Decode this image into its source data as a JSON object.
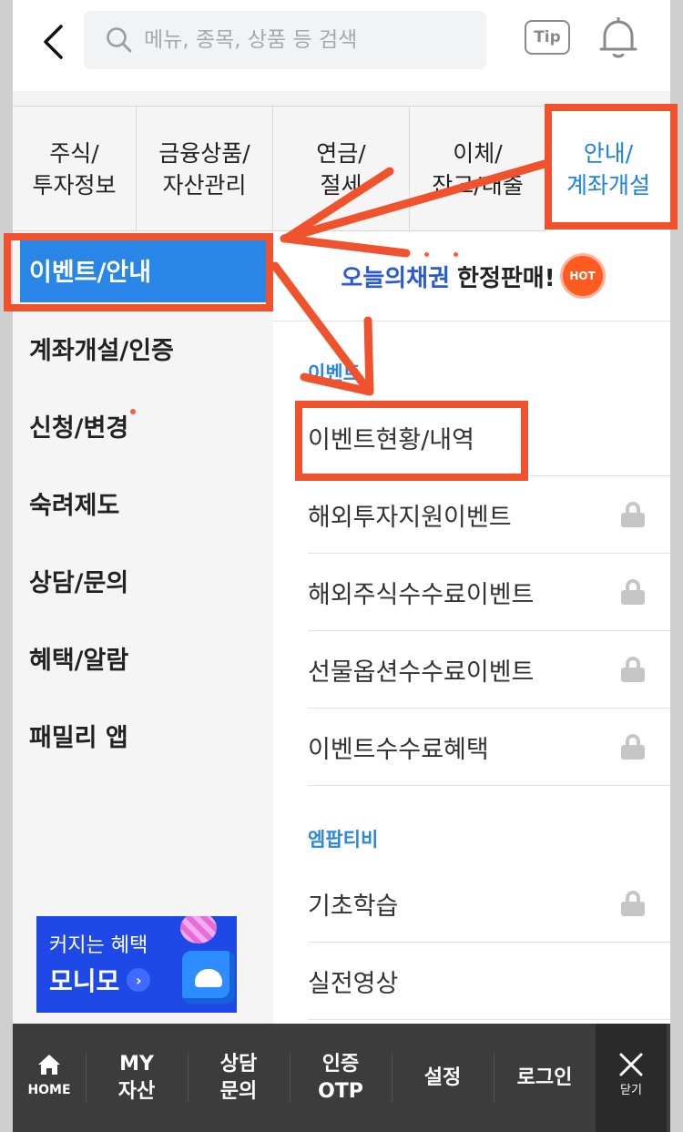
{
  "header": {
    "search_placeholder": "메뉴, 종목, 상품 등 검색",
    "tip_label": "Tip"
  },
  "tabs": [
    {
      "line1": "주식/",
      "line2": "투자정보"
    },
    {
      "line1": "금융상품/",
      "line2": "자산관리"
    },
    {
      "line1": "연금/",
      "line2": "절세"
    },
    {
      "line1": "이체/",
      "line2": "잔고/대출"
    },
    {
      "line1": "안내/",
      "line2": "계좌개설"
    }
  ],
  "sidebar": {
    "items": [
      "이벤트/안내",
      "계좌개설/인증",
      "신청/변경",
      "숙려제도",
      "상담/문의",
      "혜택/알람",
      "패밀리 앱"
    ]
  },
  "promo": {
    "line1": "커지는 혜택",
    "line2": "모니모"
  },
  "content": {
    "bond_banner": {
      "highlight": "오늘의채권",
      "rest": "한정판매!",
      "badge": "HOT"
    },
    "event_section_label": "이벤트",
    "event_items": [
      {
        "label": "이벤트현황/내역",
        "locked": false
      },
      {
        "label": "해외투자지원이벤트",
        "locked": true
      },
      {
        "label": "해외주식수수료이벤트",
        "locked": true
      },
      {
        "label": "선물옵션수수료이벤트",
        "locked": true
      },
      {
        "label": "이벤트수수료혜택",
        "locked": true
      }
    ],
    "emp_section_label": "엠팝티비",
    "emp_items": [
      {
        "label": "기초학습",
        "locked": true
      },
      {
        "label": "실전영상",
        "locked": false
      }
    ]
  },
  "bottom_bar": {
    "home": "HOME",
    "my": {
      "line1": "MY",
      "line2": "자산"
    },
    "consult": {
      "line1": "상담",
      "line2": "문의"
    },
    "otp": {
      "line1": "인증",
      "line2": "OTP"
    },
    "settings": "설정",
    "login": "로그인",
    "close": "닫기"
  },
  "colors": {
    "accent_blue": "#2a86e6",
    "annotation_red": "#f0522e",
    "bottom_bar": "#3c3c3c"
  }
}
